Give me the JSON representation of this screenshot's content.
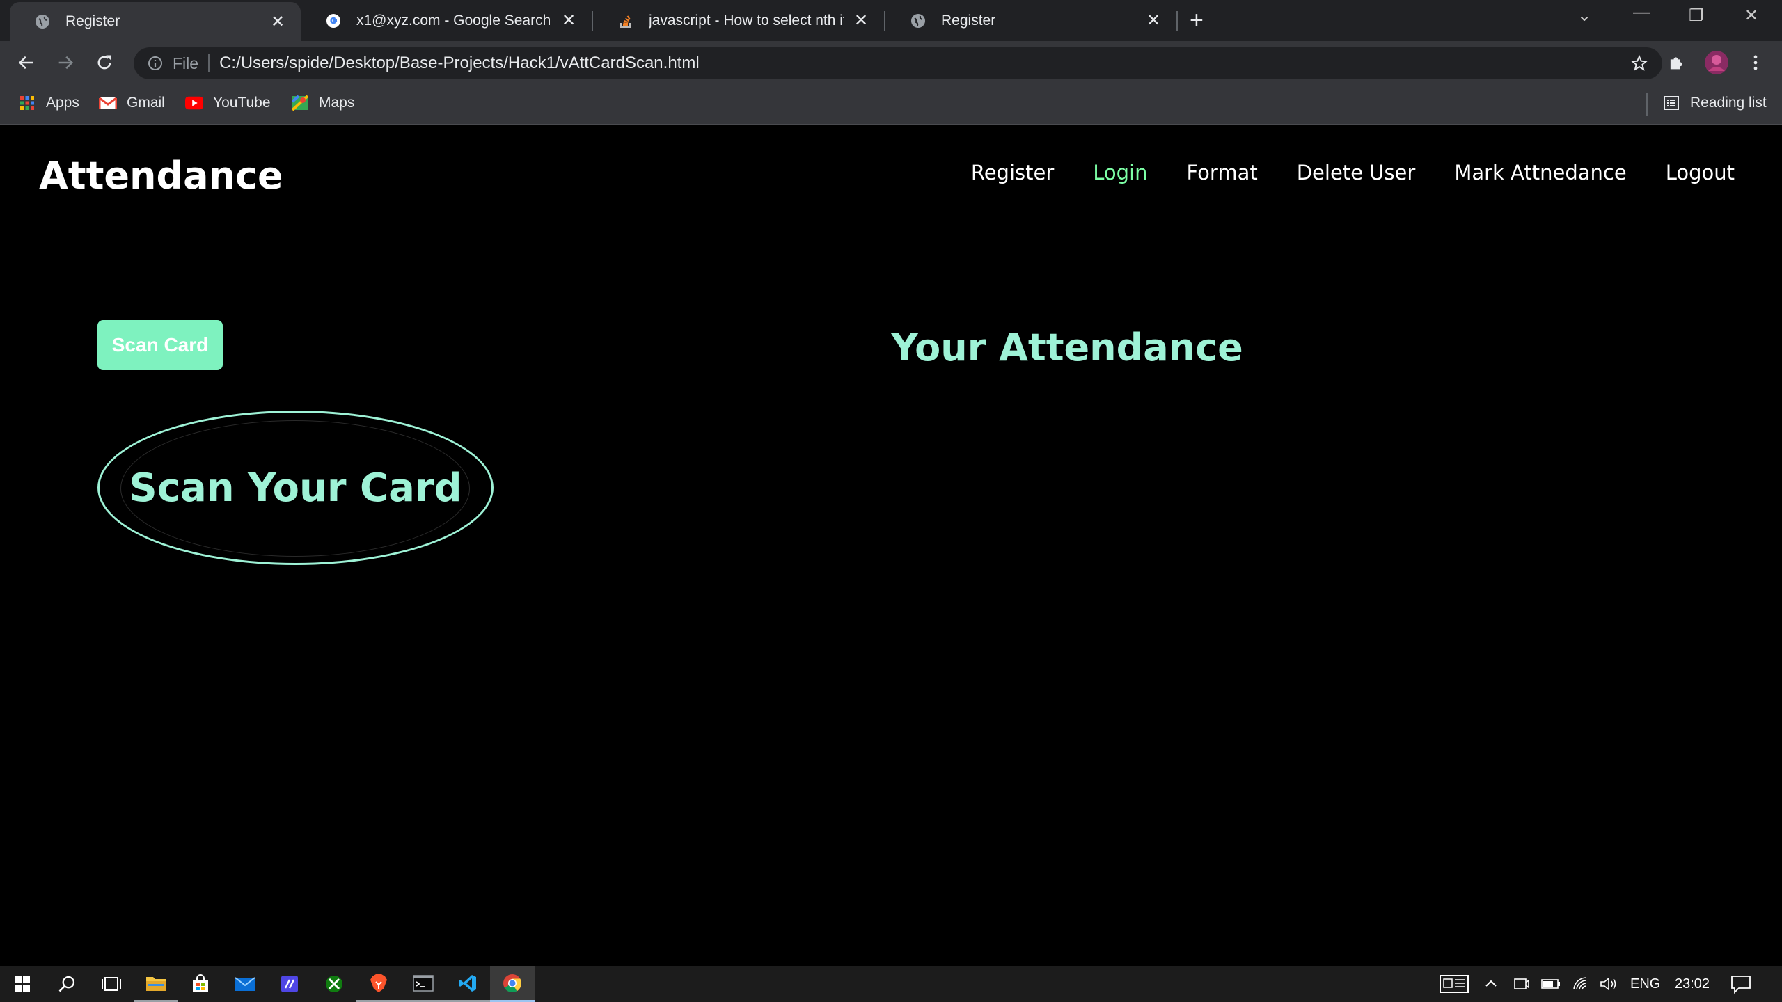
{
  "browser": {
    "tabs": [
      {
        "title": "Register",
        "icon": "globe-icon",
        "active": true
      },
      {
        "title": "x1@xyz.com - Google Search",
        "icon": "google-icon",
        "active": false
      },
      {
        "title": "javascript - How to select nth iter",
        "icon": "stackoverflow-icon",
        "active": false
      },
      {
        "title": "Register",
        "icon": "globe-icon",
        "active": false
      }
    ],
    "address": {
      "scheme_label": "File",
      "url": "C:/Users/spide/Desktop/Base-Projects/Hack1/vAttCardScan.html"
    },
    "bookmarks": [
      {
        "label": "Apps",
        "icon": "apps-grid-icon"
      },
      {
        "label": "Gmail",
        "icon": "gmail-icon"
      },
      {
        "label": "YouTube",
        "icon": "youtube-icon"
      },
      {
        "label": "Maps",
        "icon": "maps-icon"
      }
    ],
    "reading_list_label": "Reading list"
  },
  "page": {
    "brand": "Attendance",
    "nav": [
      {
        "label": "Register",
        "active": false
      },
      {
        "label": "Login",
        "active": true
      },
      {
        "label": "Format",
        "active": false
      },
      {
        "label": "Delete User",
        "active": false
      },
      {
        "label": "Mark Attnedance",
        "active": false
      },
      {
        "label": "Logout",
        "active": false
      }
    ],
    "scan_button_label": "Scan Card",
    "scan_prompt": "Scan Your Card",
    "attendance_heading": "Your Attendance",
    "colors": {
      "accent": "#9ef2d6",
      "button": "#7ef2bf",
      "active_nav": "#7dffa6",
      "background": "#000000"
    }
  },
  "taskbar": {
    "apps": [
      "windows-start-icon",
      "search-icon",
      "task-view-icon",
      "file-explorer-icon",
      "store-icon",
      "mail-icon",
      "app-icon",
      "xbox-icon",
      "brave-icon",
      "terminal-icon",
      "vscode-icon",
      "chrome-icon"
    ],
    "language": "ENG",
    "time": "23:02"
  }
}
